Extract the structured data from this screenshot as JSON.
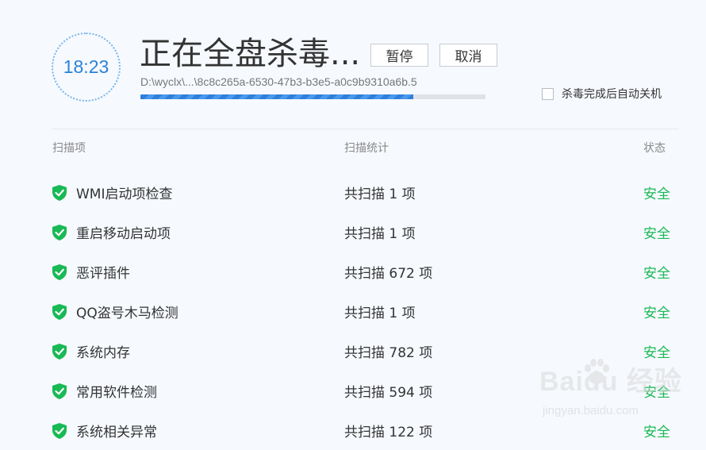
{
  "scan": {
    "timer": "18:23",
    "title": "正在全盘杀毒...",
    "current_path": "D:\\wyclx\\...\\8c8c265a-6530-47b3-b3e5-a0c9b9310a6b.5",
    "progress": 0.79,
    "pause_label": "暂停",
    "cancel_label": "取消",
    "auto_shutdown_label": "杀毒完成后自动关机",
    "auto_shutdown_checked": false
  },
  "table": {
    "headers": {
      "item": "扫描项",
      "stats": "扫描统计",
      "status": "状态"
    },
    "rows": [
      {
        "name": "WMI启动项检查",
        "stats": "共扫描 1 项",
        "status": "安全"
      },
      {
        "name": "重启移动启动项",
        "stats": "共扫描 1 项",
        "status": "安全"
      },
      {
        "name": "恶评插件",
        "stats": "共扫描 672 项",
        "status": "安全"
      },
      {
        "name": "QQ盗号木马检测",
        "stats": "共扫描 1 项",
        "status": "安全"
      },
      {
        "name": "系统内存",
        "stats": "共扫描 782 项",
        "status": "安全"
      },
      {
        "name": "常用软件检测",
        "stats": "共扫描 594 项",
        "status": "安全"
      },
      {
        "name": "系统相关异常",
        "stats": "共扫描 122 项",
        "status": "安全"
      }
    ]
  },
  "colors": {
    "accent": "#2a82d8",
    "safe": "#19b955",
    "shield": "#19b955"
  },
  "icons": {
    "row_status": "shield-check-icon",
    "watermark": "baidu-paw-icon"
  },
  "watermark": {
    "logo": "Baidu 经验",
    "url": "jingyan.baidu.com"
  }
}
